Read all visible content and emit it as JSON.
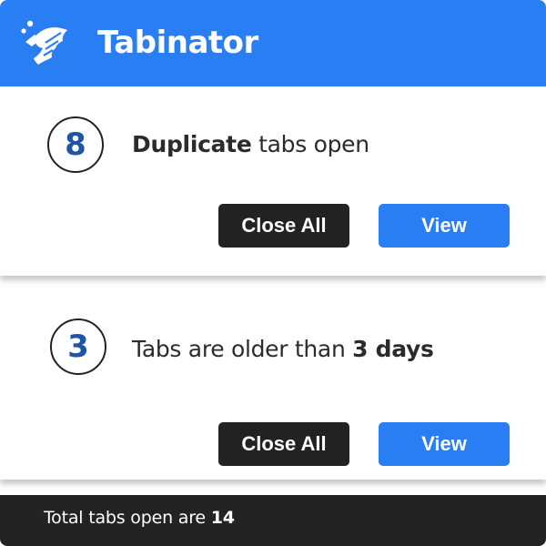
{
  "app": {
    "title": "Tabinator",
    "logo_icon": "broom-icon",
    "brand_color": "#2a7ef3",
    "dark_color": "#222222"
  },
  "duplicates": {
    "count": "8",
    "label_bold": "Duplicate",
    "label_rest": " tabs open",
    "close_all_label": "Close All",
    "view_label": "View"
  },
  "old_tabs": {
    "count": "3",
    "label_prefix": "Tabs are older than ",
    "label_bold": "3 days",
    "close_all_label": "Close All",
    "view_label": "View"
  },
  "footer": {
    "label": "Total tabs open are ",
    "total": "14"
  }
}
